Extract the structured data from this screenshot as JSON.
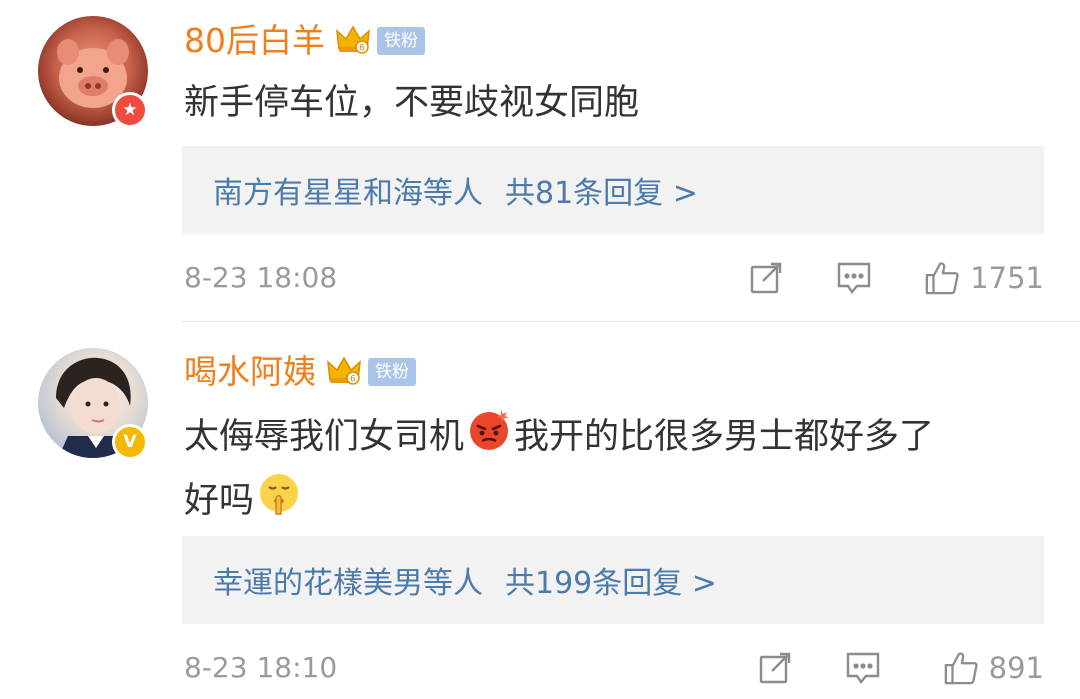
{
  "comments": [
    {
      "username": "80后白羊",
      "fan_badge": "铁粉",
      "text": "新手停车位，不要歧视女同胞",
      "replies_preview": "南方有星星和海等人",
      "replies_count": "共81条回复 >",
      "timestamp": "8-23 18:08",
      "likes": "1751",
      "verified_badge": "star-badge",
      "badge_color": "#ee4c3f"
    },
    {
      "username": "喝水阿姨",
      "fan_badge": "铁粉",
      "text_part1": "太侮辱我们女司机",
      "text_part2": "我开的比很多男士都好多了",
      "text_part3": "好吗",
      "emoji1": "angry-face-emoji",
      "emoji2": "shushing-face-emoji",
      "replies_preview": "幸運的花樣美男等人",
      "replies_count": "共199条回复 >",
      "timestamp": "8-23 18:10",
      "likes": "891",
      "verified_badge": "v-badge",
      "badge_color": "#f5b800"
    }
  ],
  "colors": {
    "username": "#f07f1b",
    "reply_link": "#4b7aab",
    "meta_gray": "#9a9a9a",
    "fan_badge_bg": "#aac4e8"
  }
}
